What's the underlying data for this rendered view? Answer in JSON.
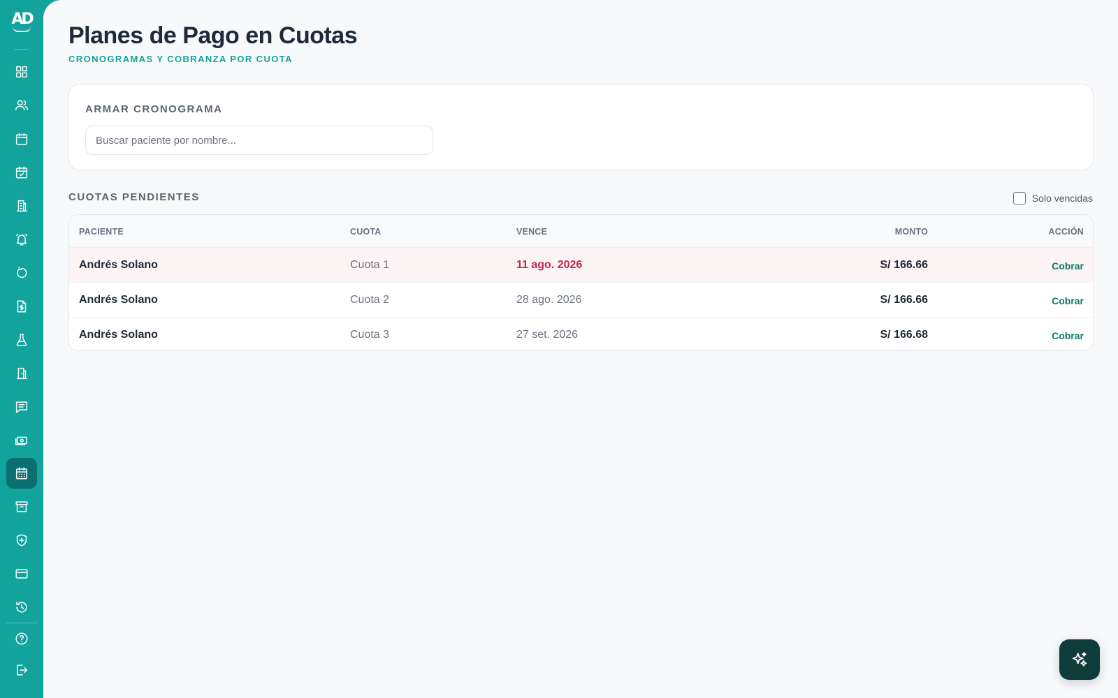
{
  "app": {
    "logo_text": "AD"
  },
  "sidebar": {
    "items": [
      {
        "icon": "dashboard-grid-icon"
      },
      {
        "icon": "patients-icon"
      },
      {
        "icon": "calendar-icon"
      },
      {
        "icon": "calendar-check-icon"
      },
      {
        "icon": "building-icon"
      },
      {
        "icon": "bell-alarm-icon"
      },
      {
        "icon": "refresh-icon"
      },
      {
        "icon": "invoice-icon"
      },
      {
        "icon": "lab-flask-icon"
      },
      {
        "icon": "door-icon"
      },
      {
        "icon": "messages-icon"
      },
      {
        "icon": "cash-icon"
      },
      {
        "icon": "installments-calendar-icon",
        "active": true
      },
      {
        "icon": "archive-icon"
      },
      {
        "icon": "shield-plus-icon"
      },
      {
        "icon": "credit-card-icon"
      },
      {
        "icon": "history-icon"
      }
    ],
    "bottom": [
      {
        "icon": "help-icon"
      },
      {
        "icon": "logout-icon"
      }
    ]
  },
  "header": {
    "title": "Planes de Pago en Cuotas",
    "subtitle": "CRONOGRAMAS Y COBRANZA POR CUOTA"
  },
  "schedule_card": {
    "title": "ARMAR CRONOGRAMA",
    "search_placeholder": "Buscar paciente por nombre..."
  },
  "pending": {
    "title": "CUOTAS PENDIENTES",
    "filter_label": "Solo vencidas",
    "filter_checked": false,
    "columns": {
      "patient": "PACIENTE",
      "quota": "CUOTA",
      "due": "VENCE",
      "amount": "MONTO",
      "action": "ACCIÓN"
    },
    "rows": [
      {
        "patient": "Andrés Solano",
        "quota": "Cuota 1",
        "due": "11 ago. 2026",
        "amount": "S/ 166.66",
        "action": "Cobrar",
        "overdue": true
      },
      {
        "patient": "Andrés Solano",
        "quota": "Cuota 2",
        "due": "28 ago. 2026",
        "amount": "S/ 166.66",
        "action": "Cobrar",
        "overdue": false
      },
      {
        "patient": "Andrés Solano",
        "quota": "Cuota 3",
        "due": "27 set. 2026",
        "amount": "S/ 166.68",
        "action": "Cobrar",
        "overdue": false
      }
    ]
  },
  "colors": {
    "sidebar": "#12a39c",
    "sidebar_active": "#0c6f6f",
    "accent": "#12a39c",
    "overdue": "#c5264b",
    "action": "#0f7a6c",
    "fab": "#0f3b3b"
  },
  "fab": {
    "icon": "ai-sparkles-icon"
  }
}
